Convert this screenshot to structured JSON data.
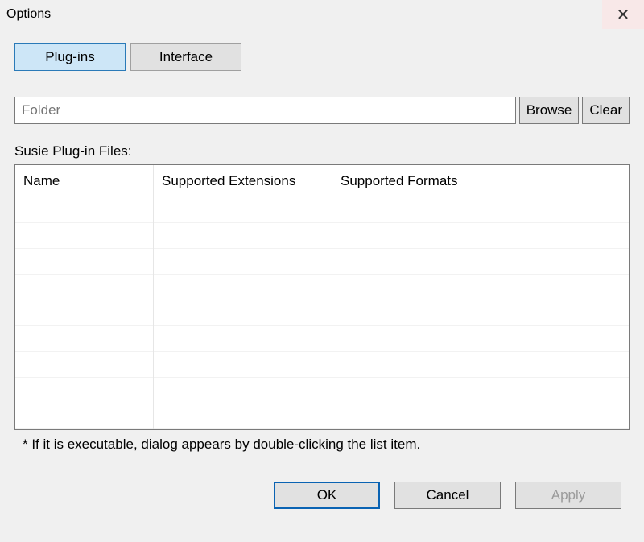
{
  "window": {
    "title": "Options"
  },
  "tabs": {
    "plugins": "Plug-ins",
    "interface": "Interface",
    "active": "plugins"
  },
  "folder": {
    "placeholder": "Folder",
    "value": "",
    "browse": "Browse",
    "clear": "Clear"
  },
  "list": {
    "label": "Susie Plug-in Files:",
    "columns": {
      "name": "Name",
      "extensions": "Supported Extensions",
      "formats": "Supported Formats"
    },
    "rows": []
  },
  "hint": "* If it is executable, dialog appears by double-clicking the list item.",
  "buttons": {
    "ok": "OK",
    "cancel": "Cancel",
    "apply": "Apply"
  }
}
